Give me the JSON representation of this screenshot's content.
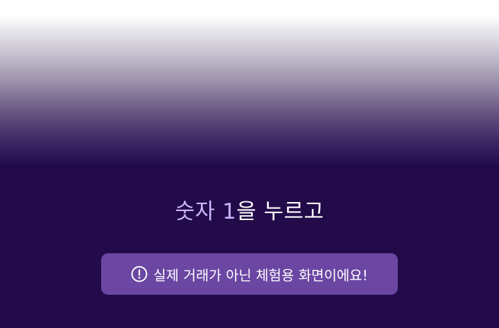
{
  "instruction": {
    "part1": "숫자 ",
    "digit": "1",
    "part2": "을 누르고"
  },
  "notice": {
    "icon": "exclamation-circle-icon",
    "text": "실제 거래가 아닌 체험용 화면이에요!"
  },
  "colors": {
    "background": "#230b4a",
    "notice_background": "#6b47a3",
    "highlight": "#cdb4ff",
    "text": "#ffffff"
  }
}
